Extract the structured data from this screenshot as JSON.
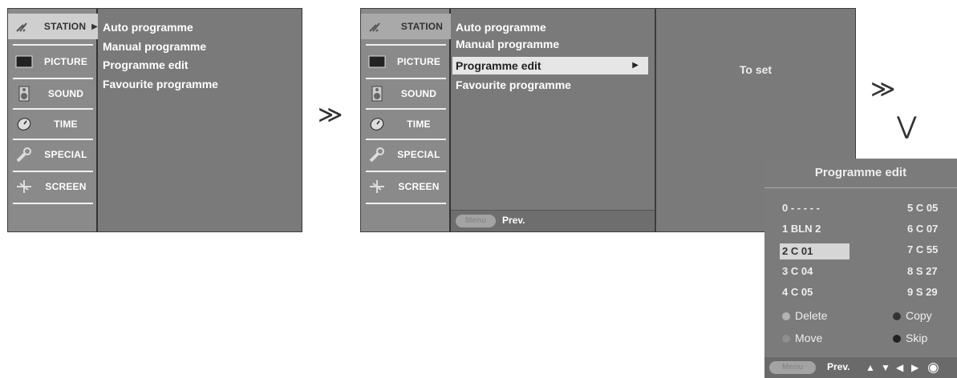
{
  "sidebar_items": [
    {
      "label": "STATION"
    },
    {
      "label": "PICTURE"
    },
    {
      "label": "SOUND"
    },
    {
      "label": "TIME"
    },
    {
      "label": "SPECIAL"
    },
    {
      "label": "SCREEN"
    }
  ],
  "station_menu": {
    "items": [
      "Auto programme",
      "Manual programme",
      "Programme edit",
      "Favourite programme"
    ]
  },
  "footer": {
    "menu_button": "Menu",
    "prev_label": "Prev."
  },
  "to_set_label": "To set",
  "arrows": {
    "right": "≫",
    "down": "⋁"
  },
  "programme_edit": {
    "title": "Programme edit",
    "left_column": [
      "0 - - - - -",
      "1 BLN 2",
      "2  C  01",
      "3  C  04",
      "4  C  05"
    ],
    "right_column": [
      "5  C  05",
      "6  C  07",
      "7  C  55",
      "8  S  27",
      "9  S  29"
    ],
    "selected_index": 2,
    "options": {
      "delete": "Delete",
      "copy": "Copy",
      "move": "Move",
      "skip": "Skip"
    },
    "nav": {
      "up": "▲",
      "down": "▼",
      "left": "◀",
      "right": "▶",
      "ok": "◉"
    }
  },
  "colors": {
    "panel": "#7d7d7d",
    "sidebar": "#8a8a8a",
    "highlight": "#e6e6e6"
  }
}
